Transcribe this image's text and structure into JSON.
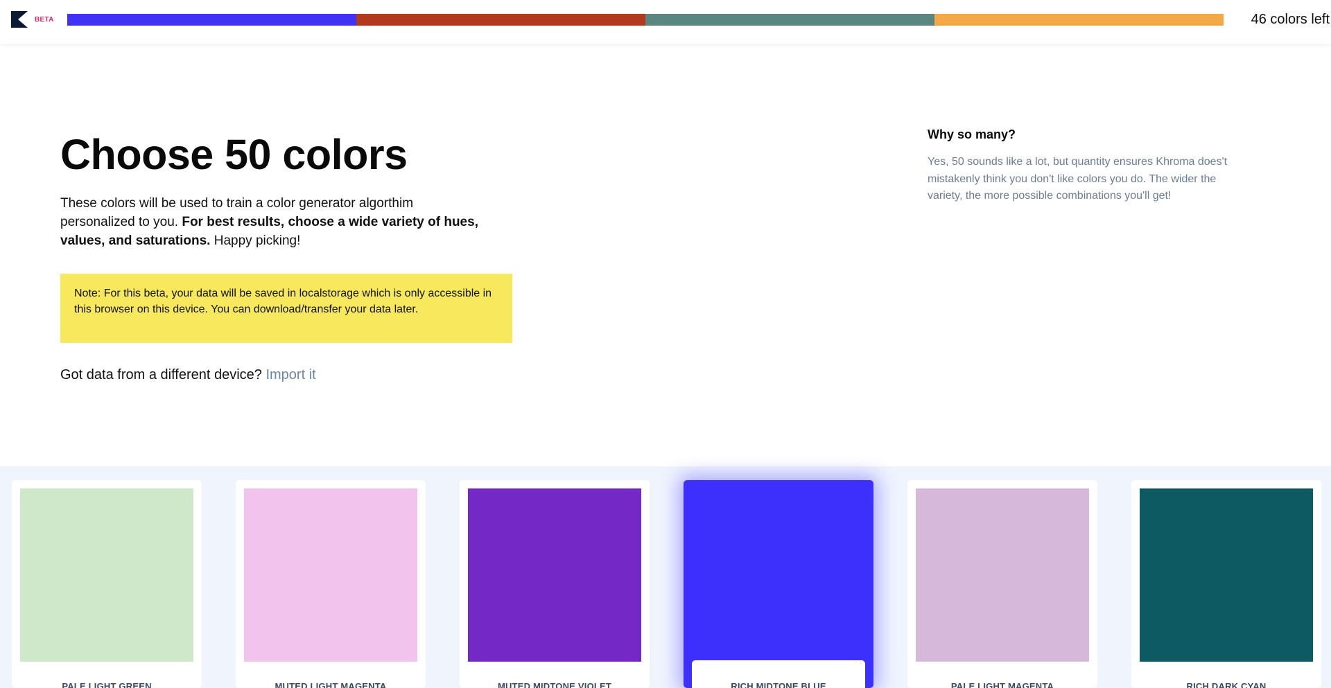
{
  "header": {
    "beta_label": "BETA",
    "progress_colors": [
      "#4232f5",
      "#b2391d",
      "#5a8580",
      "#f3a948"
    ],
    "colors_left": "46 colors left"
  },
  "intro": {
    "title": "Choose 50 colors",
    "text_before": "These colors will be used to train a color generator algorthim personalized to you. ",
    "text_bold": "For best results, choose a wide variety of hues, values, and saturations.",
    "text_after": " Happy picking!",
    "note": "Note: For this beta, your data will be saved in localstorage which is only accessible in this browser on this device. You can download/transfer your data later.",
    "import_question": "Got data from a different device? ",
    "import_link": "Import it"
  },
  "sidebar": {
    "title": "Why so many?",
    "text": "Yes, 50 sounds like a lot, but quantity ensures Khroma does't mistakenly think you don't like colors you do. The wider the variety, the more possible combinations you'll get!"
  },
  "swatches": [
    {
      "label": "PALE LIGHT GREEN",
      "color": "#cfe8c9",
      "selected": false
    },
    {
      "label": "MUTED LIGHT MAGENTA",
      "color": "#f2c3ec",
      "selected": false
    },
    {
      "label": "MUTED MIDTONE VIOLET",
      "color": "#7429c6",
      "selected": false
    },
    {
      "label": "RICH MIDTONE BLUE",
      "color": "#3d2ffc",
      "selected": true
    },
    {
      "label": "PALE LIGHT MAGENTA",
      "color": "#d6b9da",
      "selected": false
    },
    {
      "label": "RICH DARK CYAN",
      "color": "#0d5a62",
      "selected": false
    }
  ]
}
